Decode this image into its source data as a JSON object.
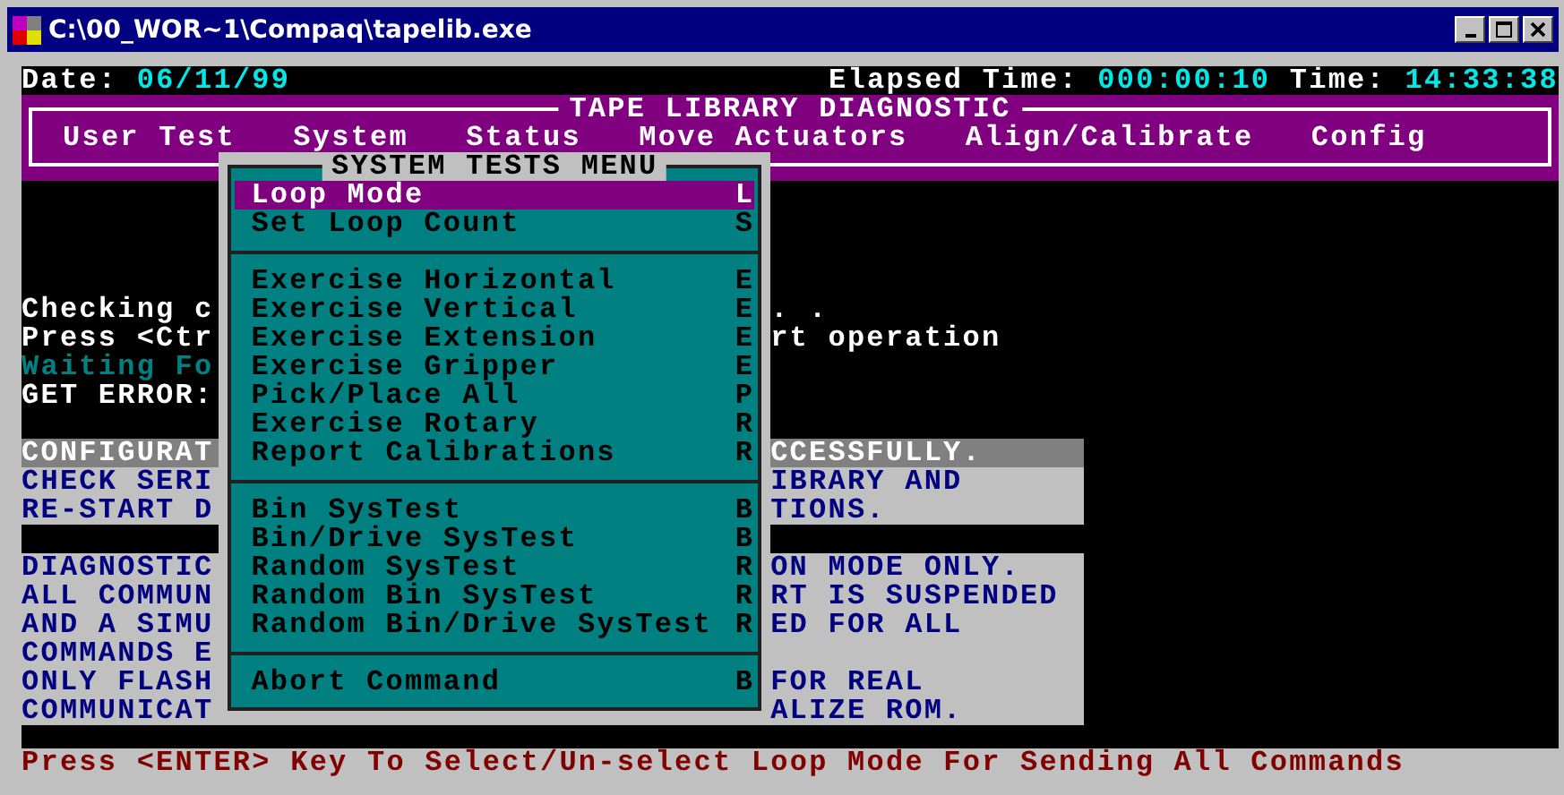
{
  "window": {
    "title": "C:\\00_WOR~1\\Compaq\\tapelib.exe"
  },
  "header": {
    "date_label": "Date:",
    "date": "06/11/99",
    "elapsed_label": "Elapsed Time:",
    "elapsed": "000:00:10",
    "time_label": "Time:",
    "time": "14:33:38"
  },
  "app_title": "TAPE LIBRARY DIAGNOSTIC",
  "menu_bar": [
    "User Test",
    "System",
    "Status",
    "Move Actuators",
    "Align/Calibrate",
    "Config"
  ],
  "console_lines": [
    {
      "kind": "normal",
      "left": "Checking c",
      "right": ". ."
    },
    {
      "kind": "normal",
      "left": "Press <Ctr",
      "right": "rt operation"
    },
    {
      "kind": "waiting",
      "left": "Waiting Fo"
    },
    {
      "kind": "normal",
      "left": "GET ERROR:"
    }
  ],
  "notice_boxes": [
    {
      "lines": [
        {
          "left": "CONFIGURAT",
          "right": "CCESSFULLY.",
          "highlighted": true
        },
        {
          "left": "CHECK SERI",
          "right": "IBRARY AND",
          "highlighted": false
        },
        {
          "left": "RE-START D",
          "right": "TIONS.",
          "highlighted": false
        }
      ]
    },
    {
      "lines": [
        {
          "left": "DIAGNOSTIC",
          "right": "ON MODE ONLY.",
          "highlighted": false
        },
        {
          "left": "ALL COMMUN",
          "right": "RT IS SUSPENDED",
          "highlighted": false
        },
        {
          "left": "AND A SIMU",
          "right": "ED FOR ALL",
          "highlighted": false
        },
        {
          "left": "COMMANDS E",
          "highlighted": false
        },
        {
          "left": "ONLY FLASH",
          "right": "FOR REAL",
          "highlighted": false
        },
        {
          "left": "COMMUNICAT",
          "right": "ALIZE ROM.",
          "highlighted": false
        }
      ]
    }
  ],
  "popup": {
    "title": "SYSTEM TESTS MENU",
    "sections": [
      [
        {
          "label": "Loop Mode",
          "key": "L",
          "selected": true
        },
        {
          "label": "Set Loop Count",
          "key": "S",
          "selected": false
        }
      ],
      [
        {
          "label": "Exercise Horizontal",
          "key": "E",
          "selected": false
        },
        {
          "label": "Exercise Vertical",
          "key": "E",
          "selected": false
        },
        {
          "label": "Exercise Extension",
          "key": "E",
          "selected": false
        },
        {
          "label": "Exercise Gripper",
          "key": "E",
          "selected": false
        },
        {
          "label": "Pick/Place All",
          "key": "P",
          "selected": false
        },
        {
          "label": "Exercise Rotary",
          "key": "R",
          "selected": false
        },
        {
          "label": "Report Calibrations",
          "key": "R",
          "selected": false
        }
      ],
      [
        {
          "label": "Bin SysTest",
          "key": "B",
          "selected": false
        },
        {
          "label": "Bin/Drive SysTest",
          "key": "B",
          "selected": false
        },
        {
          "label": "Random SysTest",
          "key": "R",
          "selected": false
        },
        {
          "label": "Random Bin SysTest",
          "key": "R",
          "selected": false
        },
        {
          "label": "Random Bin/Drive SysTest",
          "key": "R",
          "selected": false
        }
      ],
      [
        {
          "label": "Abort Command",
          "key": "B",
          "selected": false
        }
      ]
    ]
  },
  "status_bar": "Press <ENTER> Key To Select/Un-select Loop Mode For Sending All Commands"
}
